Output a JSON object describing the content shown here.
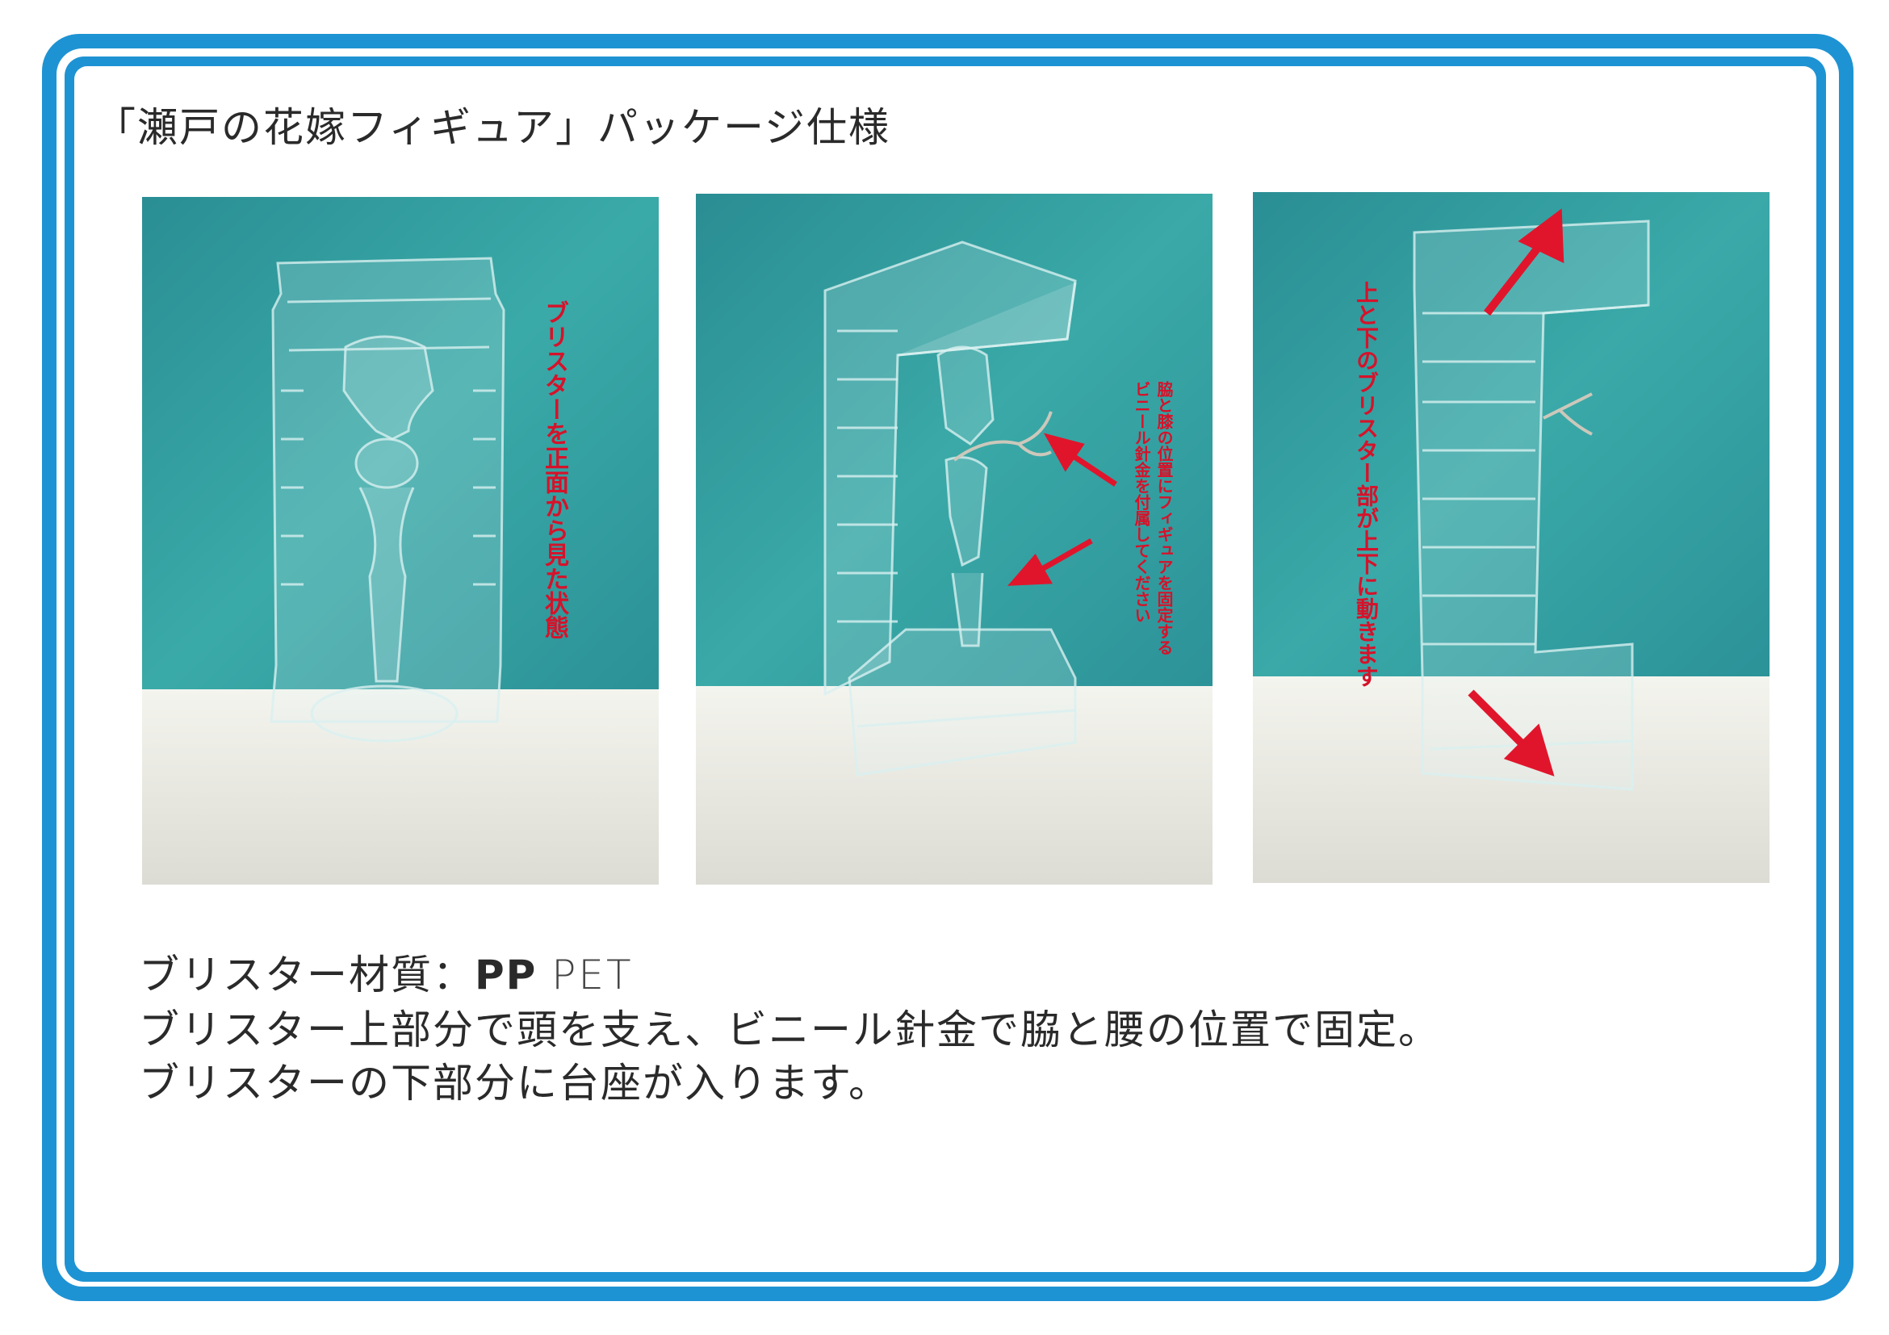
{
  "title": "「瀬戸の花嫁フィギュア」パッケージ仕様",
  "photos": [
    {
      "label": "ブリスターを正面から見た状態"
    },
    {
      "label_line1": "脇と膝の位置にフィギュアを固定する",
      "label_line2": "ビニール針金を付属してください"
    },
    {
      "label": "上と下のブリスター部が上下に動きます"
    }
  ],
  "specs": {
    "material_prefix": "ブリスター材質：",
    "material_pp": "PP",
    "material_pet": "PET",
    "line2": "ブリスター上部分で頭を支え、ビニール針金で脇と腰の位置で固定。",
    "line3": "ブリスターの下部分に台座が入ります。"
  },
  "colors": {
    "frame": "#1e93d3",
    "annotation": "#d6122a",
    "wall": "#2f9fa2",
    "table": "#ecece6"
  }
}
